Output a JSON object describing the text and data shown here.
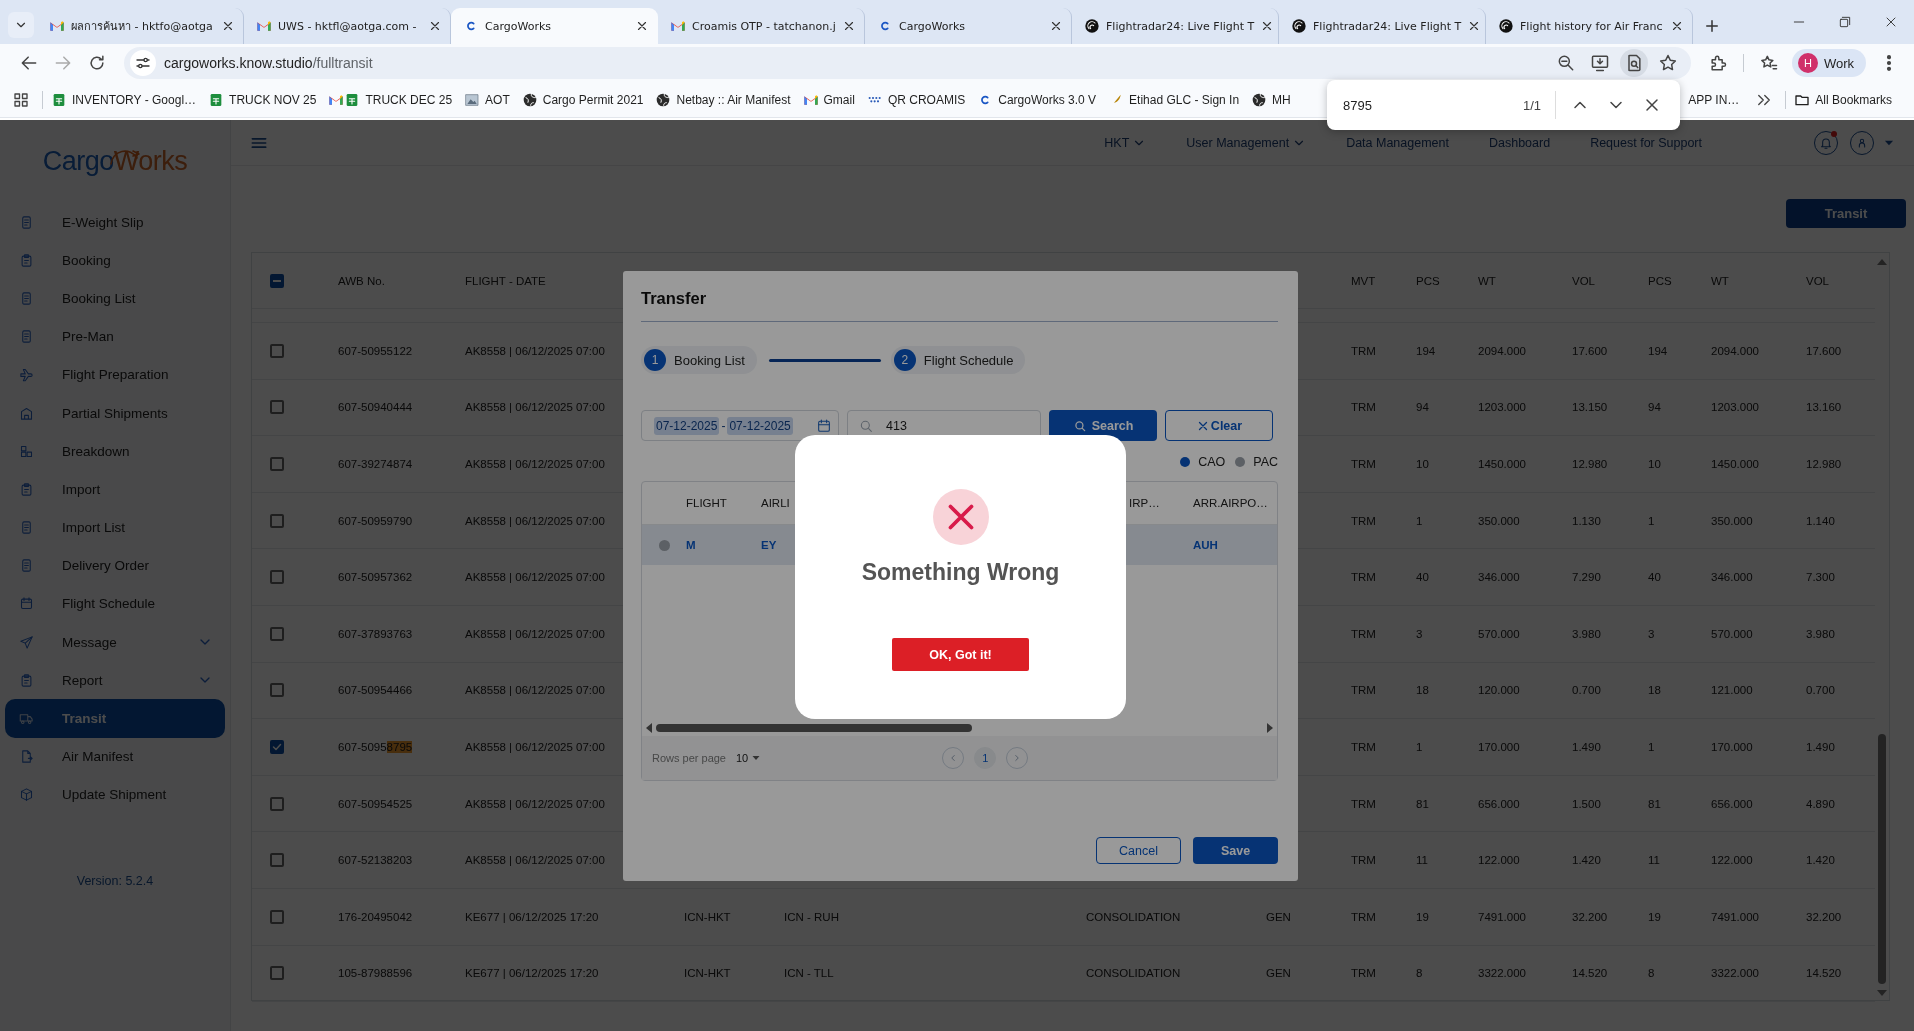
{
  "browser": {
    "tabs": [
      {
        "kind": "gmail",
        "title": "ผลการค้นหา - hktfo@aotga",
        "selected": false
      },
      {
        "kind": "gmail",
        "title": "UWS - hktfl@aotga.com -",
        "selected": false
      },
      {
        "kind": "cargoworks",
        "title": "CargoWorks",
        "selected": true
      },
      {
        "kind": "gmail",
        "title": "Croamis OTP - tatchanon.j",
        "selected": false
      },
      {
        "kind": "cargoworks",
        "title": "CargoWorks",
        "selected": false
      },
      {
        "kind": "radar",
        "title": "Flightradar24: Live Flight T",
        "selected": false
      },
      {
        "kind": "radar",
        "title": "Flightradar24: Live Flight T",
        "selected": false
      },
      {
        "kind": "radar",
        "title": "Flight history for Air Franc",
        "selected": false
      }
    ],
    "address": {
      "host": "cargoworks.know.studio",
      "path": "/fulltransit"
    },
    "profile": {
      "initial": "H",
      "label": "Work"
    },
    "bookmarks": [
      {
        "kind": "sheets",
        "label": "INVENTORY - Googl…"
      },
      {
        "kind": "sheets",
        "label": "TRUCK NOV 25"
      },
      {
        "kind": "gmail"
      },
      {
        "kind": "sheets",
        "label": "TRUCK DEC 25"
      },
      {
        "kind": "image",
        "label": "AOT"
      },
      {
        "kind": "globe",
        "label": "Cargo Permit 2021"
      },
      {
        "kind": "globe",
        "label": "Netbay :: Air Manifest"
      },
      {
        "kind": "gmail",
        "label": "Gmail"
      },
      {
        "kind": "dots",
        "label": "QR CROAMIS"
      },
      {
        "kind": "cargoworks",
        "label": "CargoWorks 3.0 V"
      },
      {
        "kind": "feather",
        "label": "Etihad GLC - Sign In"
      },
      {
        "kind": "globe",
        "label": "MH"
      }
    ],
    "bookmarks_right": [
      {
        "label": "APP IN…"
      }
    ],
    "all_bookmarks": "All Bookmarks",
    "find_bar": {
      "query": "8795",
      "count": "1/1"
    }
  },
  "sidebar": {
    "logo": [
      "Cargo",
      "Works"
    ],
    "items": [
      {
        "label": "E-Weight Slip",
        "selected": false,
        "expandable": false
      },
      {
        "label": "Booking",
        "selected": false,
        "expandable": false
      },
      {
        "label": "Booking List",
        "selected": false,
        "expandable": false
      },
      {
        "label": "Pre-Man",
        "selected": false,
        "expandable": false
      },
      {
        "label": "Flight Preparation",
        "selected": false,
        "expandable": false
      },
      {
        "label": "Partial Shipments",
        "selected": false,
        "expandable": false
      },
      {
        "label": "Breakdown",
        "selected": false,
        "expandable": false
      },
      {
        "label": "Import",
        "selected": false,
        "expandable": false
      },
      {
        "label": "Import List",
        "selected": false,
        "expandable": false
      },
      {
        "label": "Delivery Order",
        "selected": false,
        "expandable": false
      },
      {
        "label": "Flight Schedule",
        "selected": false,
        "expandable": false
      },
      {
        "label": "Message",
        "selected": false,
        "expandable": true
      },
      {
        "label": "Report",
        "selected": false,
        "expandable": true
      },
      {
        "label": "Transit",
        "selected": true,
        "expandable": false
      },
      {
        "label": "Air Manifest",
        "selected": false,
        "expandable": false
      },
      {
        "label": "Update Shipment",
        "selected": false,
        "expandable": false
      }
    ],
    "version": "Version: 5.2.4"
  },
  "header": {
    "nav": [
      {
        "label": "HKT",
        "dropdown": true
      },
      {
        "label": "User Management",
        "dropdown": true
      },
      {
        "label": "Data Management",
        "dropdown": false
      },
      {
        "label": "Dashboard",
        "dropdown": false
      },
      {
        "label": "Request for Support",
        "dropdown": false
      }
    ],
    "unread": true
  },
  "transit_button": "Transit",
  "table": {
    "select_all": {
      "checked": true,
      "indeterminate": true
    },
    "left_columns": [
      "AWB No.",
      "FLIGHT - DATE"
    ],
    "right_columns": [
      "MVT",
      "PCS",
      "WT",
      "VOL",
      "PCS",
      "WT",
      "VOL"
    ],
    "rows": [
      {
        "checked": false,
        "awb": "607-50955122",
        "flight_date": "AK8558 | 06/12/2025 07:00",
        "values": [
          "TRM",
          "194",
          "2094.000",
          "17.600",
          "194",
          "2094.000",
          "17.600"
        ]
      },
      {
        "checked": false,
        "awb": "607-50940444",
        "flight_date": "AK8558 | 06/12/2025 07:00",
        "values": [
          "TRM",
          "94",
          "1203.000",
          "13.150",
          "94",
          "1203.000",
          "13.160"
        ]
      },
      {
        "checked": false,
        "awb": "607-39274874",
        "flight_date": "AK8558 | 06/12/2025 07:00",
        "values": [
          "TRM",
          "10",
          "1450.000",
          "12.980",
          "10",
          "1450.000",
          "12.980"
        ]
      },
      {
        "checked": false,
        "awb": "607-50959790",
        "flight_date": "AK8558 | 06/12/2025 07:00",
        "values": [
          "TRM",
          "1",
          "350.000",
          "1.130",
          "1",
          "350.000",
          "1.140"
        ]
      },
      {
        "checked": false,
        "awb": "607-50957362",
        "flight_date": "AK8558 | 06/12/2025 07:00",
        "values": [
          "TRM",
          "40",
          "346.000",
          "7.290",
          "40",
          "346.000",
          "7.300"
        ]
      },
      {
        "checked": false,
        "awb": "607-37893763",
        "flight_date": "AK8558 | 06/12/2025 07:00",
        "values": [
          "TRM",
          "3",
          "570.000",
          "3.980",
          "3",
          "570.000",
          "3.980"
        ]
      },
      {
        "checked": false,
        "awb": "607-50954466",
        "flight_date": "AK8558 | 06/12/2025 07:00",
        "values": [
          "TRM",
          "18",
          "120.000",
          "0.700",
          "18",
          "121.000",
          "0.700"
        ]
      },
      {
        "checked": true,
        "awb": "607-5095",
        "awb_match": "8795",
        "flight_date": "AK8558 | 06/12/2025 07:00",
        "values": [
          "TRM",
          "1",
          "170.000",
          "1.490",
          "1",
          "170.000",
          "1.490"
        ]
      },
      {
        "checked": false,
        "awb": "607-50954525",
        "flight_date": "AK8558 | 06/12/2025 07:00",
        "values": [
          "TRM",
          "81",
          "656.000",
          "1.500",
          "81",
          "656.000",
          "4.890"
        ]
      },
      {
        "checked": false,
        "awb": "607-52138203",
        "flight_date": "AK8558 | 06/12/2025 07:00",
        "values": [
          "TRM",
          "11",
          "122.000",
          "1.420",
          "11",
          "122.000",
          "1.420"
        ]
      },
      {
        "checked": false,
        "awb": "176-20495042",
        "flight_date": "KE677 | 06/12/2025 17:20",
        "column_4": "ICN-HKT",
        "column_5": "ICN - RUH",
        "column_6": "CONSOLIDATION",
        "column_7": "GEN",
        "values": [
          "TRM",
          "19",
          "7491.000",
          "32.200",
          "19",
          "7491.000",
          "32.200"
        ]
      },
      {
        "checked": false,
        "awb": "105-87988596",
        "flight_date": "KE677 | 06/12/2025 17:20",
        "column_4": "ICN-HKT",
        "column_5": "ICN - TLL",
        "column_6": "CONSOLIDATION",
        "column_7": "GEN",
        "values": [
          "TRM",
          "8",
          "3322.000",
          "14.520",
          "8",
          "3322.000",
          "14.520"
        ]
      }
    ]
  },
  "transfer": {
    "title": "Transfer",
    "steps": [
      {
        "number": "1",
        "label": "Booking List"
      },
      {
        "number": "2",
        "label": "Flight Schedule"
      }
    ],
    "date_from": "07-12-2025",
    "date_separator": "-",
    "date_to": "07-12-2025",
    "search_value": "413",
    "search_button": "Search",
    "clear_button": "Clear",
    "aircraft_options": [
      {
        "label": "CAO",
        "selected": true
      },
      {
        "label": "PAC",
        "selected": false
      }
    ],
    "left_columns": [
      "FLIGHT",
      "AIRLI"
    ],
    "right_columns": [
      "IRP…",
      "ARR.AIRPO…"
    ],
    "rows": [
      {
        "selected": false,
        "flight": "M",
        "airline": "EY",
        "arrival": "AUH"
      }
    ],
    "rows_per_page_label": "Rows per page",
    "rows_per_page": "10",
    "pages": [
      {
        "label": "1",
        "selected": true
      }
    ],
    "cancel": "Cancel",
    "save": "Save"
  },
  "error_dialog": {
    "title": "Something Wrong",
    "button": "OK, Got it!"
  }
}
